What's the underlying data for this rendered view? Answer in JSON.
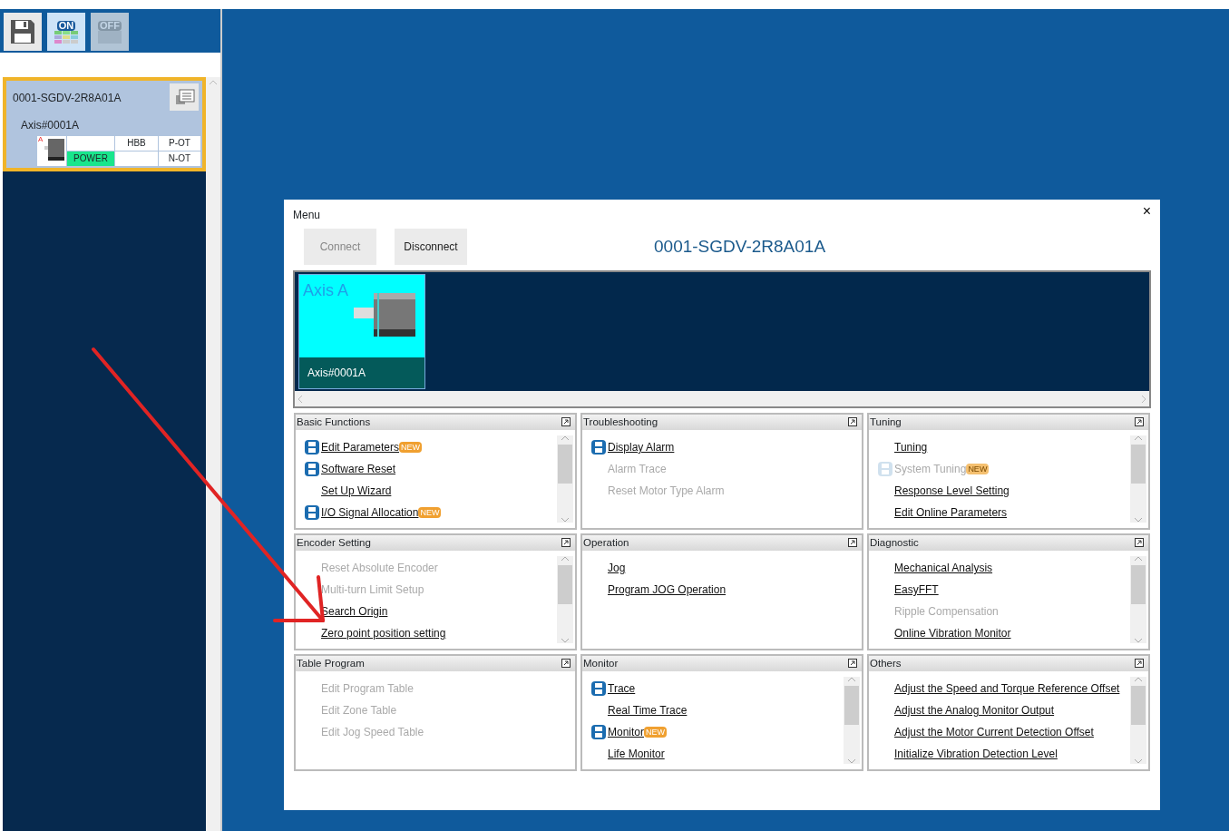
{
  "toolbar": [
    {
      "kind": "save",
      "selected": false,
      "disabled": false
    },
    {
      "kind": "on",
      "label": "ON",
      "selected": true,
      "disabled": false
    },
    {
      "kind": "off",
      "label": "OFF",
      "selected": false,
      "disabled": true
    }
  ],
  "device_card": {
    "name": "0001-SGDV-2R8A01A",
    "axis": "Axis#0001A",
    "axis_letter": "A",
    "selected": true,
    "status_cells": [
      {
        "on": false
      },
      {
        "label": "HBB",
        "on": false
      },
      {
        "label": "P-OT",
        "on": false
      },
      {
        "label": "POWER",
        "on": true
      },
      {
        "on": false
      },
      {
        "label": "N-OT",
        "on": false
      }
    ]
  },
  "dialog": {
    "title": "Menu",
    "close": "×",
    "buttons": [
      {
        "label": "Connect",
        "disabled": true
      },
      {
        "label": "Disconnect",
        "disabled": false
      }
    ],
    "device_title": "0001-SGDV-2R8A01A",
    "axes": [
      {
        "title": "Axis A",
        "name": "Axis#0001A",
        "selected": true
      }
    ],
    "sections": [
      {
        "title": "Basic Functions",
        "scrollable": true,
        "items": [
          {
            "label": "Edit Parameters",
            "kind": "icon",
            "disabled": false,
            "badge": "NEW"
          },
          {
            "label": "Software Reset",
            "kind": "icon",
            "disabled": false
          },
          {
            "label": "Set Up Wizard",
            "kind": "plain",
            "disabled": false
          },
          {
            "label": "I/O Signal Allocation",
            "kind": "icon",
            "disabled": false,
            "badge": "NEW"
          }
        ]
      },
      {
        "title": "Troubleshooting",
        "scrollable": false,
        "items": [
          {
            "label": "Display Alarm",
            "kind": "icon",
            "disabled": false
          },
          {
            "label": "Alarm Trace",
            "kind": "plain",
            "disabled": true
          },
          {
            "label": "Reset Motor Type Alarm",
            "kind": "plain",
            "disabled": true
          }
        ]
      },
      {
        "title": "Tuning",
        "scrollable": true,
        "items": [
          {
            "label": "Tuning",
            "kind": "plain",
            "disabled": false
          },
          {
            "label": "System Tuning",
            "kind": "icon",
            "disabled": true,
            "badge": "NEW"
          },
          {
            "label": "Response Level Setting",
            "kind": "plain",
            "disabled": false
          },
          {
            "label": "Edit Online Parameters",
            "kind": "plain",
            "disabled": false
          }
        ]
      },
      {
        "title": "Encoder Setting",
        "scrollable": true,
        "items": [
          {
            "label": "Reset Absolute Encoder",
            "kind": "plain",
            "disabled": true
          },
          {
            "label": "Multi-turn Limit Setup",
            "kind": "plain",
            "disabled": true
          },
          {
            "label": "Search Origin",
            "kind": "plain",
            "disabled": false
          },
          {
            "label": "Zero point position setting",
            "kind": "plain",
            "disabled": false
          }
        ]
      },
      {
        "title": "Operation",
        "scrollable": false,
        "items": [
          {
            "label": "Jog",
            "kind": "plain",
            "disabled": false
          },
          {
            "label": "Program JOG Operation",
            "kind": "plain",
            "disabled": false
          }
        ]
      },
      {
        "title": "Diagnostic",
        "scrollable": true,
        "items": [
          {
            "label": "Mechanical Analysis",
            "kind": "plain",
            "disabled": false
          },
          {
            "label": "EasyFFT",
            "kind": "plain",
            "disabled": false
          },
          {
            "label": "Ripple Compensation",
            "kind": "plain",
            "disabled": true
          },
          {
            "label": "Online Vibration Monitor",
            "kind": "plain",
            "disabled": false
          }
        ]
      },
      {
        "title": "Table Program",
        "scrollable": false,
        "items": [
          {
            "label": "Edit Program Table",
            "kind": "plain",
            "disabled": true
          },
          {
            "label": "Edit Zone Table",
            "kind": "plain",
            "disabled": true
          },
          {
            "label": "Edit Jog Speed Table",
            "kind": "plain",
            "disabled": true
          }
        ]
      },
      {
        "title": "Monitor",
        "scrollable": true,
        "items": [
          {
            "label": "Trace",
            "kind": "icon",
            "disabled": false
          },
          {
            "label": "Real Time Trace",
            "kind": "plain",
            "disabled": false
          },
          {
            "label": "Monitor",
            "kind": "icon",
            "disabled": false,
            "badge": "NEW"
          },
          {
            "label": "Life Monitor",
            "kind": "plain",
            "disabled": false
          }
        ]
      },
      {
        "title": "Others",
        "scrollable": true,
        "items": [
          {
            "label": "Adjust the Speed and Torque Reference Offset",
            "kind": "plain",
            "disabled": false
          },
          {
            "label": "Adjust the Analog Monitor Output",
            "kind": "plain",
            "disabled": false
          },
          {
            "label": "Adjust the Motor Current Detection Offset",
            "kind": "plain",
            "disabled": false
          },
          {
            "label": "Initialize Vibration Detection Level",
            "kind": "plain",
            "disabled": false
          }
        ]
      }
    ]
  }
}
